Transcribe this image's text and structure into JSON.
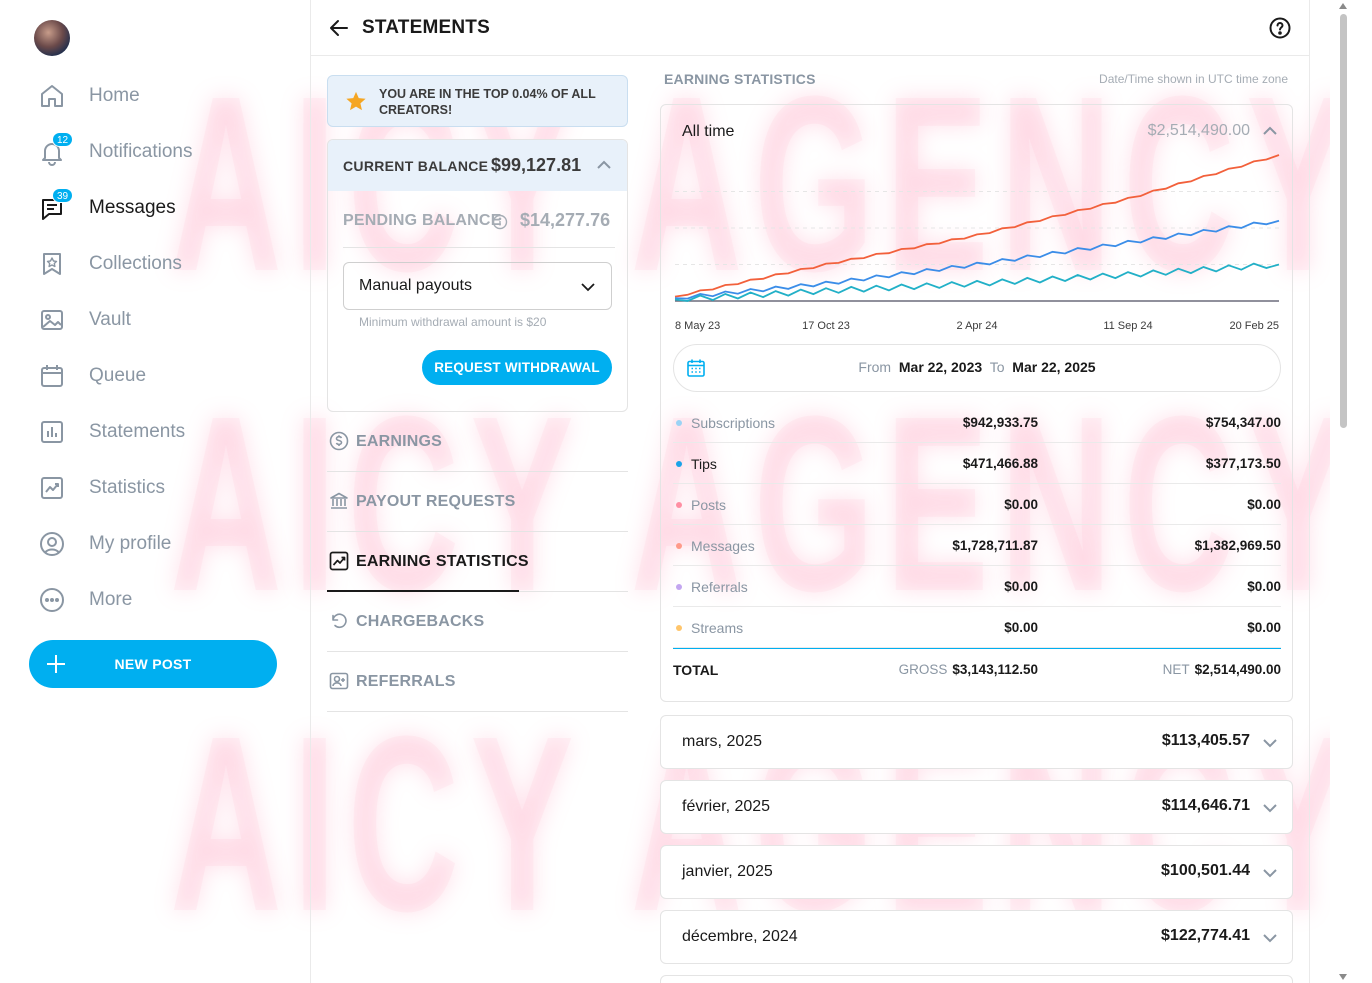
{
  "watermark": {
    "text": "AICY AGENCY"
  },
  "colors": {
    "accent": "#00aff0",
    "subscriptions": "#9bd3f5",
    "tips": "#1aa3e8",
    "posts": "#ff8fa3",
    "messages": "#ff9a8a",
    "referrals": "#c3a6f0",
    "streams": "#ffc56b",
    "line_total": "#f2603b",
    "line_messages": "#3b8de8",
    "line_tips": "#22b0c7"
  },
  "sidebar": {
    "items": [
      {
        "label": "Home",
        "icon": "home-icon"
      },
      {
        "label": "Notifications",
        "icon": "bell-icon",
        "badge": "12"
      },
      {
        "label": "Messages",
        "icon": "chat-icon",
        "badge": "39",
        "active": true
      },
      {
        "label": "Collections",
        "icon": "bookmark-icon"
      },
      {
        "label": "Vault",
        "icon": "image-icon"
      },
      {
        "label": "Queue",
        "icon": "calendar-icon"
      },
      {
        "label": "Statements",
        "icon": "bar-chart-icon"
      },
      {
        "label": "Statistics",
        "icon": "line-chart-icon"
      },
      {
        "label": "My profile",
        "icon": "user-circle-icon"
      },
      {
        "label": "More",
        "icon": "more-icon"
      }
    ],
    "new_post_label": "NEW POST"
  },
  "header": {
    "title": "STATEMENTS"
  },
  "banner": {
    "text": "YOU ARE IN THE TOP 0.04% OF ALL CREATORS!"
  },
  "balance": {
    "current_label": "CURRENT BALANCE",
    "current_value": "$99,127.81",
    "pending_label": "PENDING BALANCE",
    "pending_value": "$14,277.76",
    "payout_method": "Manual payouts",
    "min_note": "Minimum withdrawal amount is $20",
    "withdraw_label": "REQUEST WITHDRAWAL"
  },
  "menu": [
    {
      "label": "EARNINGS",
      "icon": "dollar-circle-icon"
    },
    {
      "label": "PAYOUT REQUESTS",
      "icon": "bank-icon"
    },
    {
      "label": "EARNING STATISTICS",
      "icon": "trend-chart-icon",
      "active": true
    },
    {
      "label": "CHARGEBACKS",
      "icon": "undo-icon"
    },
    {
      "label": "REFERRALS",
      "icon": "user-plus-icon"
    }
  ],
  "stats": {
    "title": "EARNING STATISTICS",
    "tz_note": "Date/Time shown in UTC time zone",
    "period_label": "All time",
    "period_total": "$2,514,490.00",
    "date_from_label": "From",
    "date_from": "Mar 22, 2023",
    "date_to_label": "To",
    "date_to": "Mar 22, 2025",
    "rows": [
      {
        "name": "Subscriptions",
        "gross": "$942,933.75",
        "net": "$754,347.00",
        "color": "#9bd3f5"
      },
      {
        "name": "Tips",
        "gross": "$471,466.88",
        "net": "$377,173.50",
        "color": "#1aa3e8",
        "dark": true
      },
      {
        "name": "Posts",
        "gross": "$0.00",
        "net": "$0.00",
        "color": "#ff8fa3"
      },
      {
        "name": "Messages",
        "gross": "$1,728,711.87",
        "net": "$1,382,969.50",
        "color": "#ff9a8a"
      },
      {
        "name": "Referrals",
        "gross": "$0.00",
        "net": "$0.00",
        "color": "#c3a6f0"
      },
      {
        "name": "Streams",
        "gross": "$0.00",
        "net": "$0.00",
        "color": "#ffc56b"
      }
    ],
    "total": {
      "label": "TOTAL",
      "gross_label": "GROSS",
      "gross": "$3,143,112.50",
      "net_label": "NET",
      "net": "$2,514,490.00"
    }
  },
  "months": [
    {
      "name": "mars, 2025",
      "value": "$113,405.57"
    },
    {
      "name": "février, 2025",
      "value": "$114,646.71"
    },
    {
      "name": "janvier, 2025",
      "value": "$100,501.44"
    },
    {
      "name": "décembre, 2024",
      "value": "$122,774.41"
    }
  ],
  "chart_data": {
    "type": "line",
    "x": [
      "8 May 23",
      "17 Oct 23",
      "2 Apr 24",
      "11 Sep 24",
      "20 Feb 25"
    ],
    "series": [
      {
        "color": "#f2603b",
        "values": [
          0.03,
          0.25,
          0.45,
          0.7,
          1.0
        ]
      },
      {
        "color": "#3b8de8",
        "values": [
          0.02,
          0.12,
          0.25,
          0.4,
          0.55
        ]
      },
      {
        "color": "#22b0c7",
        "values": [
          0.01,
          0.07,
          0.12,
          0.18,
          0.25
        ]
      }
    ],
    "grid": true
  }
}
